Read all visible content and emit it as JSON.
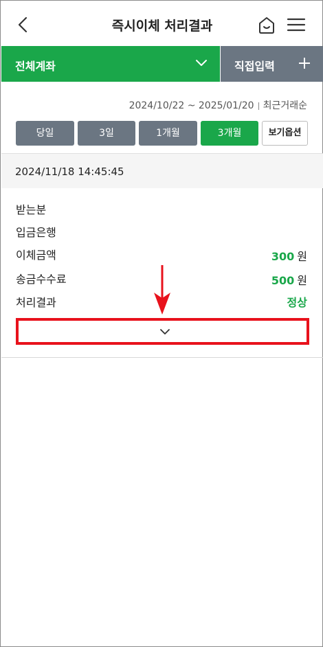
{
  "header": {
    "title": "즉시이체 처리결과",
    "icons": [
      "back-icon",
      "home-icon",
      "menu-icon"
    ]
  },
  "account_bar": {
    "select_label": "전체계좌",
    "direct_input_label": "직접입력"
  },
  "filter": {
    "date_range": "2024/10/22 ~ 2025/01/20",
    "sort": "최근거래순",
    "periods": [
      "당일",
      "3일",
      "1개월",
      "3개월"
    ],
    "active_period": "3개월",
    "options_label": "보기옵션"
  },
  "transaction": {
    "datetime": "2024/11/18 14:45:45",
    "recipient_label": "받는분",
    "bank_label": "입금은행",
    "amount_label": "이체금액",
    "amount_value": "300",
    "amount_unit": "원",
    "fee_label": "송금수수료",
    "fee_value": "500",
    "fee_unit": "원",
    "result_label": "처리결과",
    "result_value": "정상"
  },
  "colors": {
    "accent_green": "#1aa74a",
    "gray_button": "#6b7682",
    "annotation_red": "#e8121c"
  }
}
